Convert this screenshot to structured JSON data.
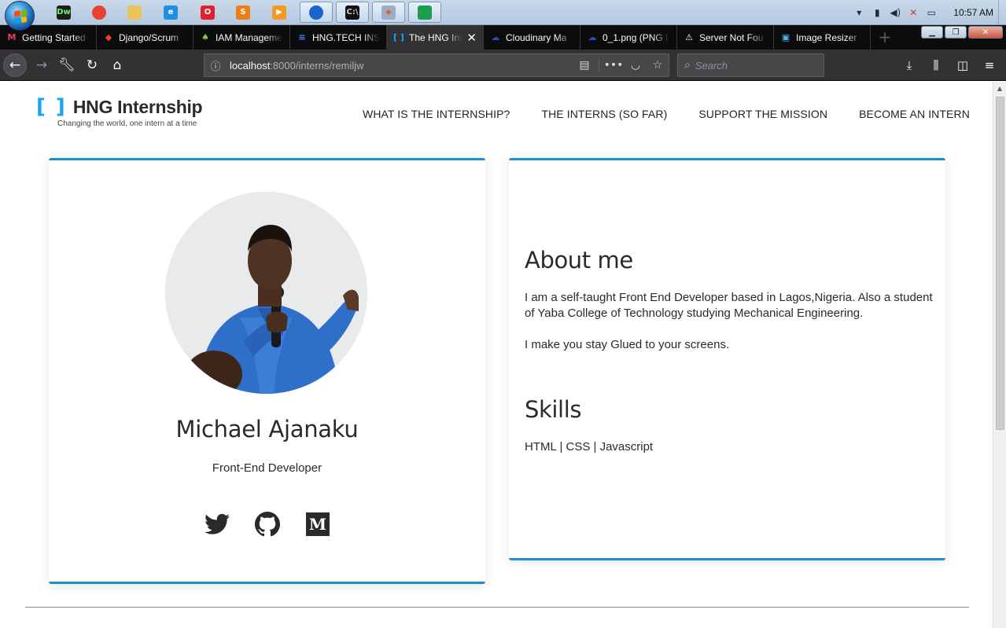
{
  "taskbar": {
    "apps": [
      {
        "name": "dreamweaver-icon",
        "label": "Dw",
        "color": "#1c1c1c",
        "fg": "#6cf46c"
      },
      {
        "name": "chrome-icon",
        "label": "",
        "color": "#e94235",
        "fg": "#fff"
      },
      {
        "name": "file-explorer-icon",
        "label": "",
        "color": "#e8c45a",
        "fg": "#fff"
      },
      {
        "name": "internet-explorer-icon",
        "label": "e",
        "color": "#1e8fe1",
        "fg": "#fff"
      },
      {
        "name": "opera-icon",
        "label": "O",
        "color": "#e0202f",
        "fg": "#fff"
      },
      {
        "name": "sublime-text-icon",
        "label": "S",
        "color": "#ef7d16",
        "fg": "#fff"
      },
      {
        "name": "media-player-icon",
        "label": "▶",
        "color": "#f39a1f",
        "fg": "#fff"
      },
      {
        "name": "firefox-icon",
        "label": "",
        "color": "#1b62d2",
        "fg": "#fff"
      },
      {
        "name": "command-prompt-icon",
        "label": "C:\\",
        "color": "#111",
        "fg": "#ccc"
      },
      {
        "name": "git-icon",
        "label": "◆",
        "color": "#9ab0c8",
        "fg": "#e65e3a"
      },
      {
        "name": "vscode-icon",
        "label": "",
        "color": "#1d9d4f",
        "fg": "#fff"
      }
    ],
    "clock": "10:57 AM"
  },
  "browser": {
    "tabs": [
      {
        "title": "Getting Started",
        "favicon": "M",
        "fav_color": "#e63e5c",
        "selected": false
      },
      {
        "title": "Django/Scrum",
        "favicon": "◆",
        "fav_color": "#e24329",
        "selected": false
      },
      {
        "title": "IAM Management",
        "favicon": "♠",
        "fav_color": "#8bc34a",
        "selected": false
      },
      {
        "title": "HNG.TECH INS",
        "favicon": "≡",
        "fav_color": "#4285f4",
        "selected": false
      },
      {
        "title": "The HNG Inte",
        "favicon": "[ ]",
        "fav_color": "#1da1f2",
        "selected": true
      },
      {
        "title": "Cloudinary Ma",
        "favicon": "☁",
        "fav_color": "#3448c5",
        "selected": false
      },
      {
        "title": "0_1.png (PNG I",
        "favicon": "☁",
        "fav_color": "#3448c5",
        "selected": false
      },
      {
        "title": "Server Not Fou",
        "favicon": "⚠",
        "fav_color": "#f9f9fa",
        "selected": false
      },
      {
        "title": "Image Resizer",
        "favicon": "▣",
        "fav_color": "#4db6e6",
        "selected": false
      }
    ],
    "url_host": "localhost",
    "url_path": ":8000/interns/remiljw",
    "search_placeholder": "Search"
  },
  "page": {
    "logo_text": "HNG Internship",
    "tagline": "Changing the world, one intern at a time",
    "nav": [
      "WHAT IS THE INTERNSHIP?",
      "THE INTERNS (SO FAR)",
      "SUPPORT THE MISSION",
      "BECOME AN INTERN"
    ],
    "profile": {
      "name": "Michael Ajanaku",
      "role": "Front-End Developer",
      "socials": [
        "twitter-icon",
        "github-icon",
        "medium-icon"
      ]
    },
    "about": {
      "title": "About me",
      "paragraph1": "I am a self-taught Front End Developer based in Lagos,Nigeria. Also a student of Yaba College of Technology studying Mechanical Engineering.",
      "paragraph2": "I make you stay Glued to your screens."
    },
    "skills": {
      "title": "Skills",
      "list": "HTML | CSS | Javascript"
    },
    "accent_color": "#1d8ed6"
  }
}
